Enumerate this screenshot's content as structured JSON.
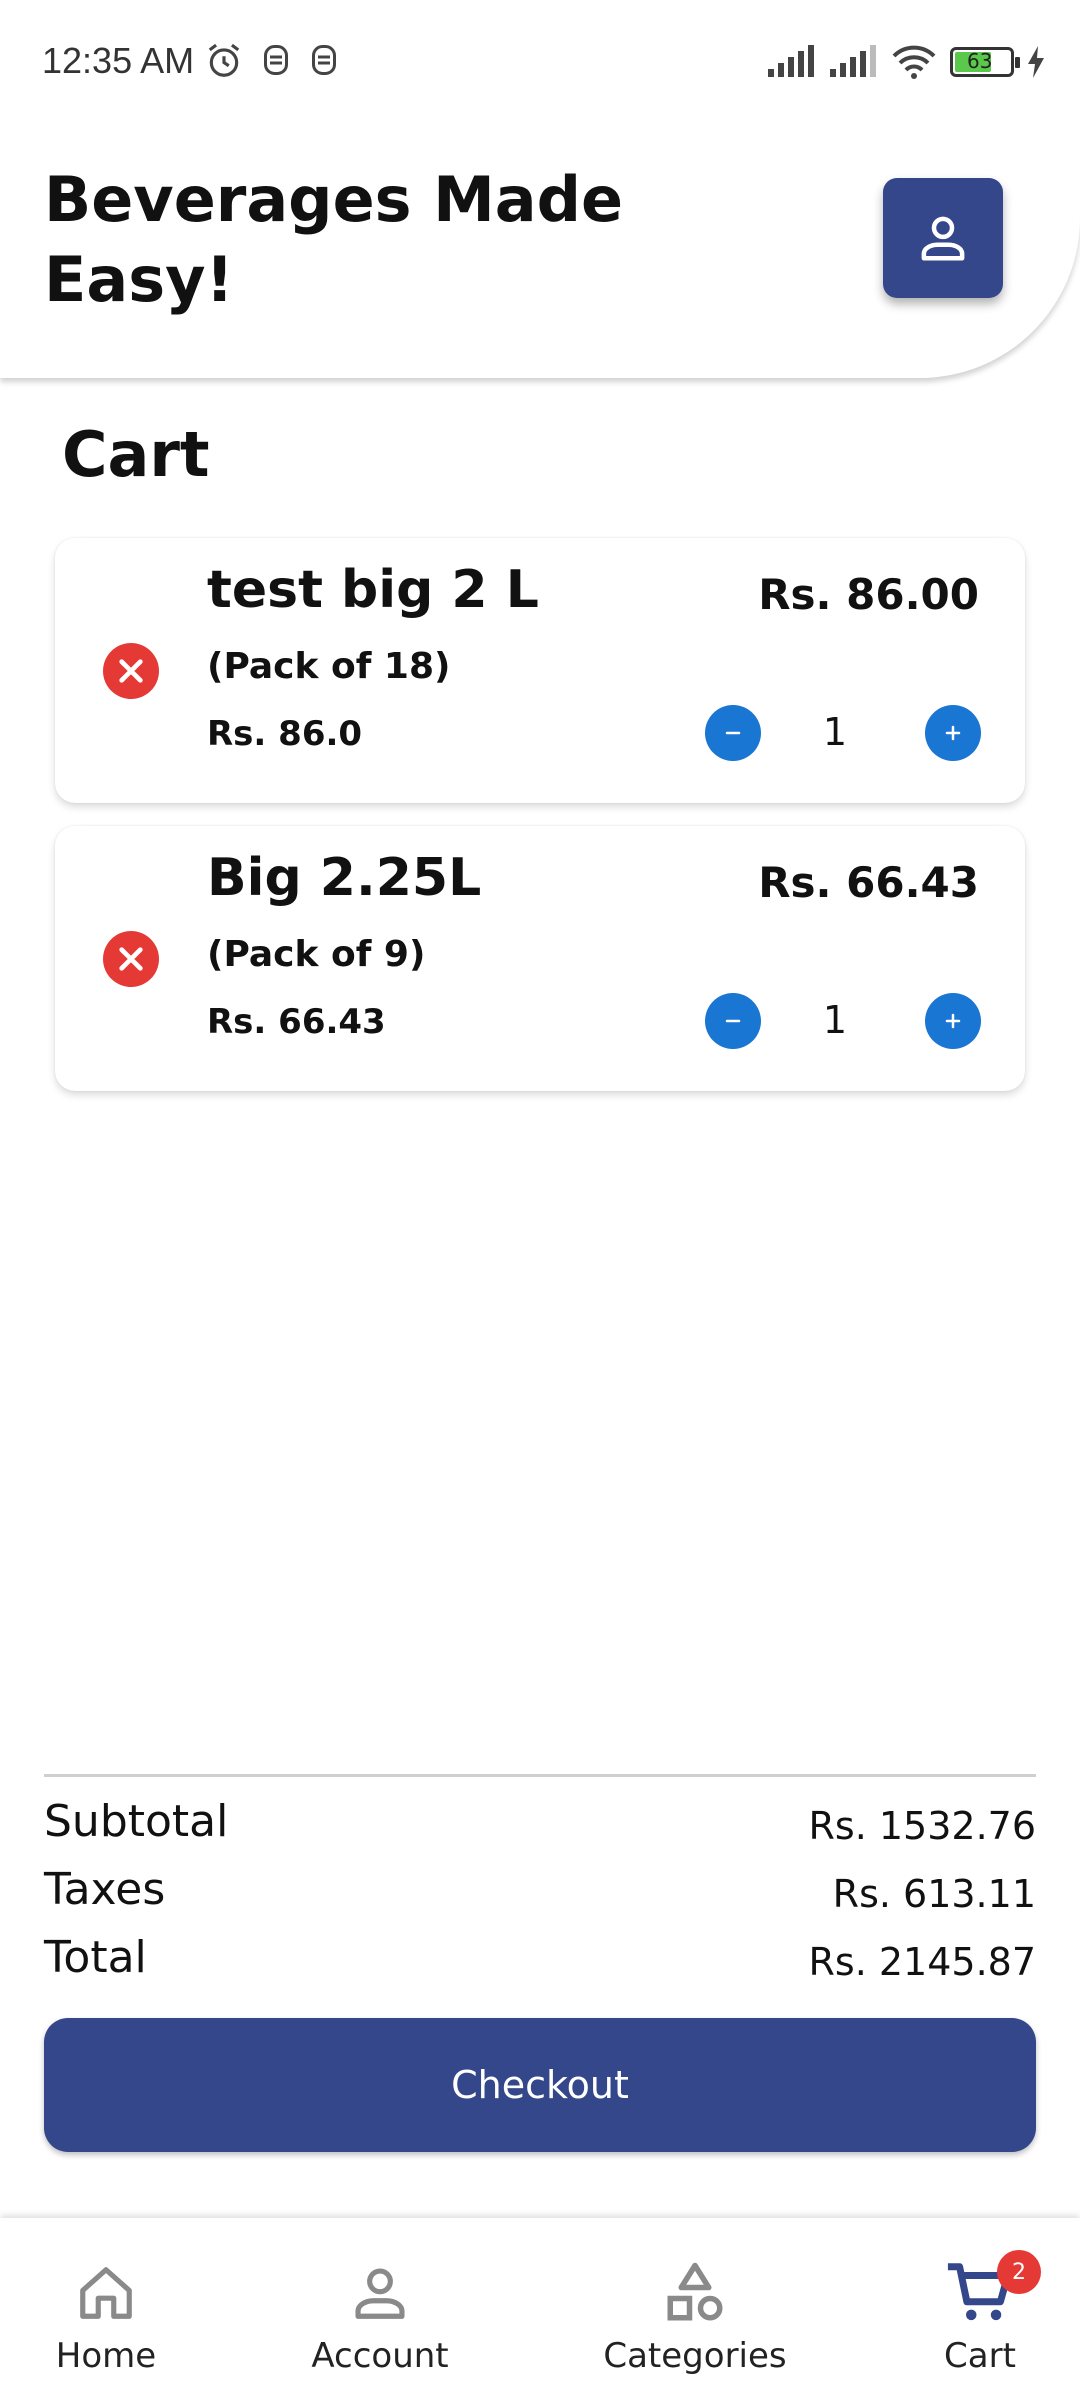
{
  "status_bar": {
    "time": "12:35 AM",
    "battery_level": "63"
  },
  "header": {
    "title": "Beverages Made Easy!",
    "profile_icon": "user-icon"
  },
  "cart": {
    "title": "Cart",
    "items": [
      {
        "name": "test big 2 L",
        "pack": "(Pack of 18)",
        "unit_price": "Rs. 86.0",
        "total": "Rs. 86.00",
        "quantity": "1"
      },
      {
        "name": "Big 2.25L",
        "pack": "(Pack of 9)",
        "unit_price": "Rs. 66.43",
        "total": "Rs. 66.43",
        "quantity": "1"
      }
    ]
  },
  "summary": {
    "subtotal_label": "Subtotal",
    "subtotal_value": "Rs. 1532.76",
    "taxes_label": "Taxes",
    "taxes_value": "Rs. 613.11",
    "total_label": "Total",
    "total_value": "Rs. 2145.87"
  },
  "checkout": {
    "label": "Checkout"
  },
  "bottom_nav": {
    "items": [
      {
        "label": "Home",
        "icon": "home-icon"
      },
      {
        "label": "Account",
        "icon": "user-icon"
      },
      {
        "label": "Categories",
        "icon": "categories-icon"
      },
      {
        "label": "Cart",
        "icon": "cart-icon",
        "badge": "2"
      }
    ]
  },
  "colors": {
    "primary": "#34478a",
    "qty_button": "#1976d2",
    "remove": "#e53935"
  }
}
